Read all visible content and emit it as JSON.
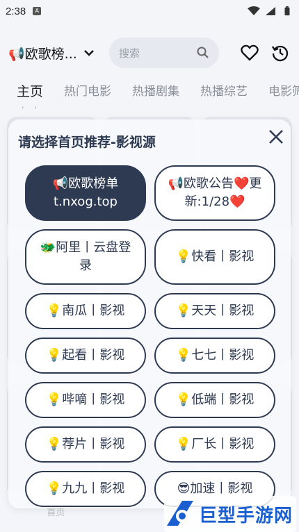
{
  "status_bar": {
    "time": "2:38",
    "sim_label": "A"
  },
  "header": {
    "source_label": "📢欧歌榜...",
    "search_placeholder": "搜索"
  },
  "tabs": [
    {
      "label": "主页",
      "active": true
    },
    {
      "label": "热门电影"
    },
    {
      "label": "热播剧集"
    },
    {
      "label": "热播综艺"
    },
    {
      "label": "电影筛"
    }
  ],
  "dialog": {
    "title": "请选择首页推荐-影视源",
    "sources": [
      {
        "label": "📢欧歌榜单 t.nxog.top",
        "selected": true
      },
      {
        "label": "📢欧歌公告❤️更新:1/28❤️"
      },
      {
        "label": "🐲阿里丨云盘登录"
      },
      {
        "label": "💡快看丨影视"
      },
      {
        "label": "💡南瓜丨影视"
      },
      {
        "label": "💡天天丨影视"
      },
      {
        "label": "💡起看丨影视"
      },
      {
        "label": "💡七七丨影视"
      },
      {
        "label": "💡哔嘀丨影视"
      },
      {
        "label": "💡低端丨影视"
      },
      {
        "label": "💡荐片丨影视"
      },
      {
        "label": "💡厂长丨影视"
      },
      {
        "label": "💡九九丨影视"
      },
      {
        "label": "😎加速丨影视"
      }
    ]
  },
  "bottom_nav": {
    "home": "首页"
  },
  "watermark": {
    "text": "巨型手游网"
  },
  "colors": {
    "accent": "#2d3a52",
    "watermark": "#1a5fd0"
  }
}
